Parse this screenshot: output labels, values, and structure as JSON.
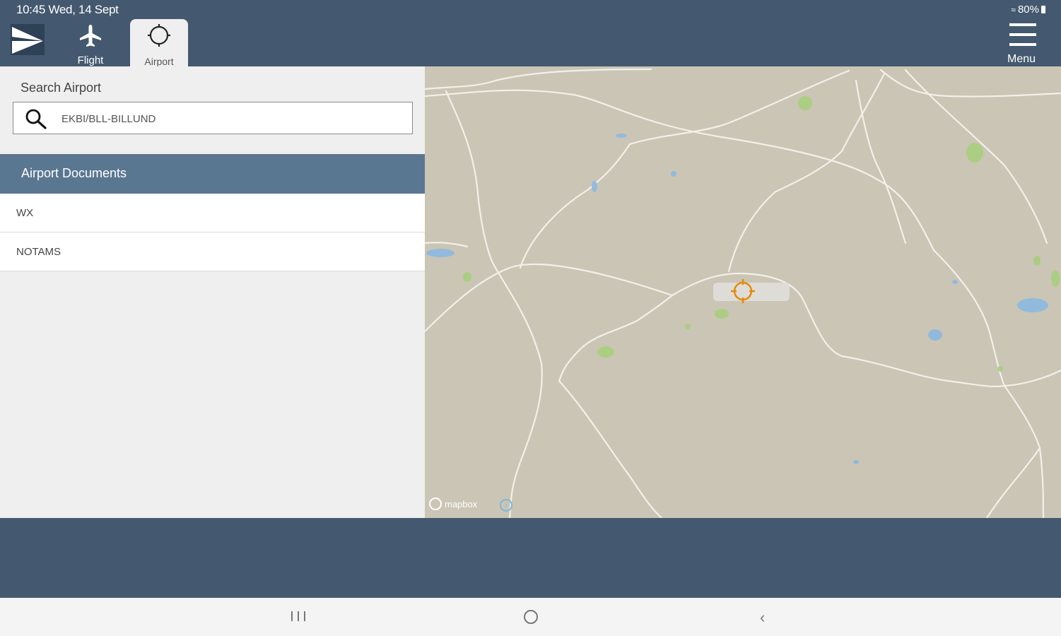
{
  "status_bar": {
    "time_date": "10:45  Wed, 14 Sept",
    "battery": "80%"
  },
  "header": {
    "tabs": [
      {
        "label": "Flight",
        "icon": "airplane-icon",
        "active": false
      },
      {
        "label": "Airport",
        "icon": "crosshair-icon",
        "active": true
      }
    ],
    "menu_label": "Menu"
  },
  "search": {
    "label": "Search Airport",
    "value": "EKBI/BLL-BILLUND"
  },
  "documents": {
    "header": "Airport Documents",
    "items": [
      {
        "label": "WX"
      },
      {
        "label": "NOTAMS"
      }
    ]
  },
  "map": {
    "provider_logo": "mapbox",
    "marker_color": "#e8890c"
  },
  "colors": {
    "header": "#44596f",
    "section_header": "#5a7791",
    "panel_bg": "#efefef",
    "map_land": "#cbc5b5"
  }
}
